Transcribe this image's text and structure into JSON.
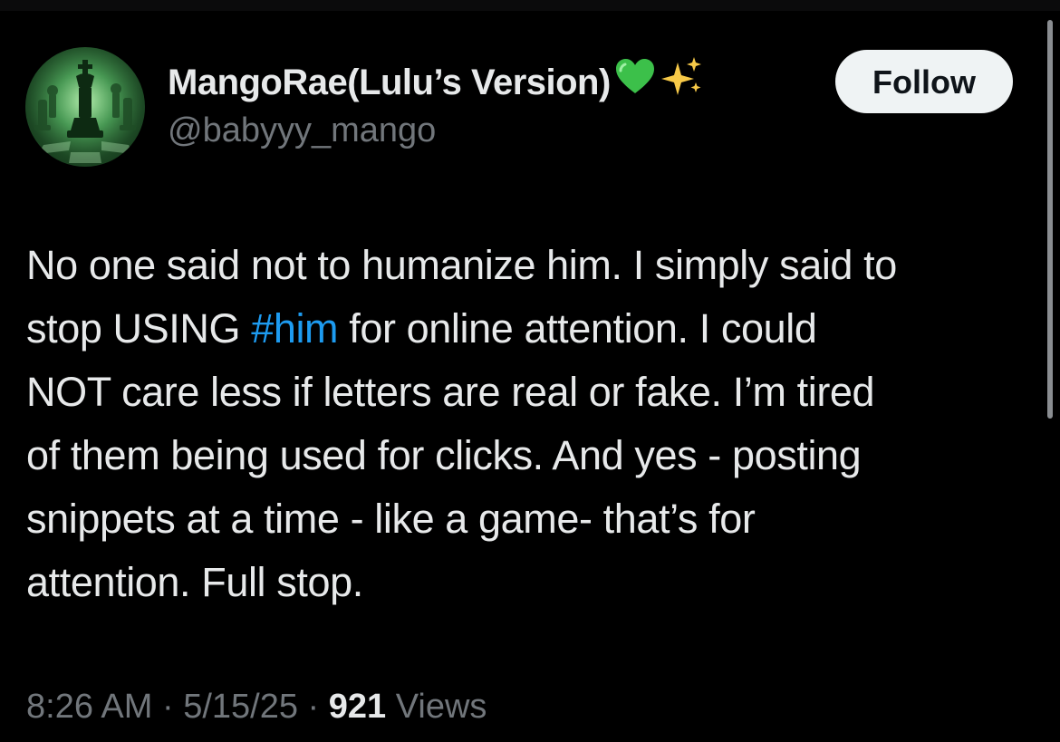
{
  "author": {
    "display_name": "MangoRae(Lulu’s Version)",
    "handle": "@babyyy_mango",
    "name_emojis": [
      "green-heart-icon",
      "sparkles-icon"
    ]
  },
  "follow_button": {
    "label": "Follow"
  },
  "tweet": {
    "lines": [
      {
        "pre": "No one said not to humanize him. I simply said to"
      },
      {
        "pre": "stop USING ",
        "hashtag": "#him",
        "post": " for online attention. I could"
      },
      {
        "pre": "NOT care less if letters are real or fake. I’m tired"
      },
      {
        "pre": "of them being used for clicks. And yes - posting"
      },
      {
        "pre": "snippets at a time - like a game- that’s for"
      },
      {
        "pre": "attention. Full stop."
      }
    ]
  },
  "meta": {
    "time": "8:26 AM",
    "sep1": " · ",
    "date": "5/15/25",
    "sep2": " · ",
    "views_count": "921",
    "views_label": " Views"
  },
  "colors": {
    "background": "#000000",
    "text": "#e7e9ea",
    "secondary": "#71767b",
    "link": "#1d9bf0",
    "follow_bg": "#eff3f4"
  }
}
